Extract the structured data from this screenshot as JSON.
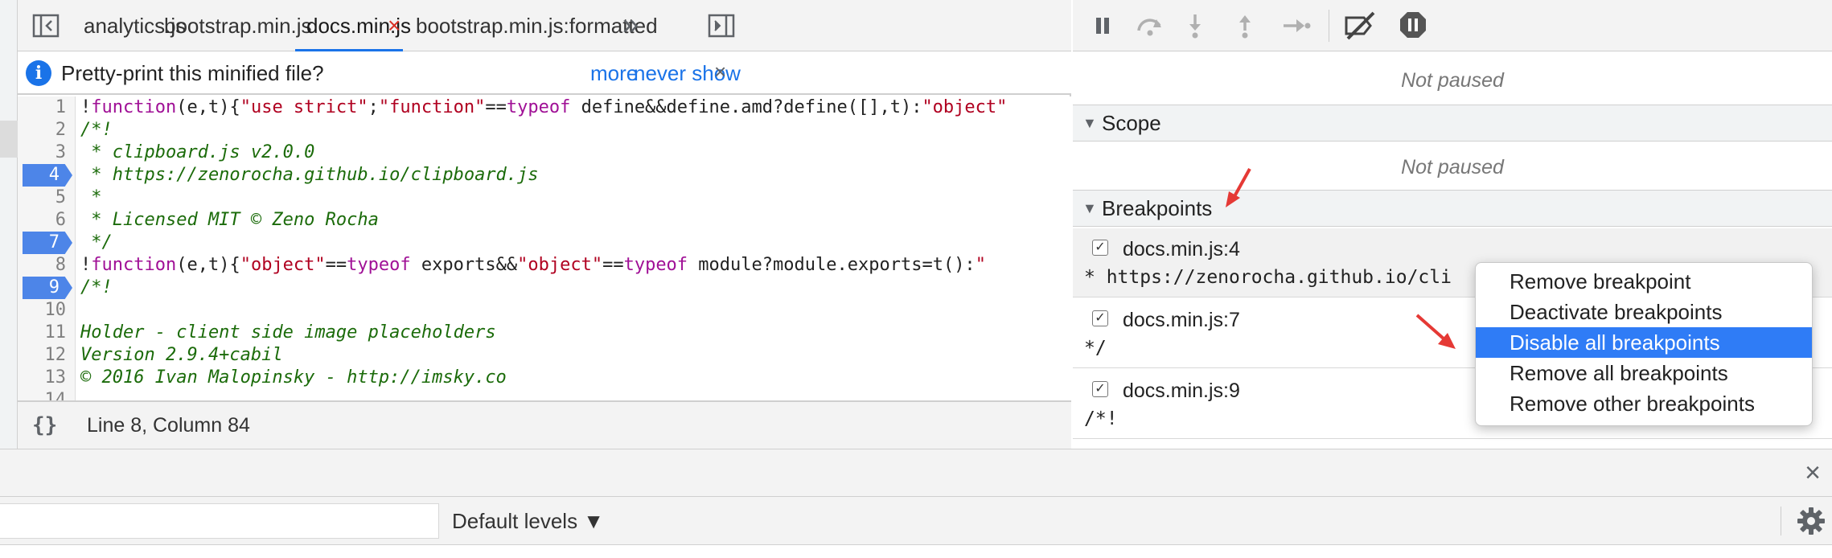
{
  "editor": {
    "tabs": [
      {
        "label": "analytics.js"
      },
      {
        "label": "bootstrap.min.js"
      },
      {
        "label": "docs.min.js",
        "active": true
      },
      {
        "label": "bootstrap.min.js:formatted"
      }
    ],
    "tab_close_glyph": "×",
    "overflow_glyph": "»",
    "infobar": {
      "message": "Pretty-print this minified file?",
      "more": "more",
      "never_show": "never show",
      "close_glyph": "×"
    },
    "lines": [
      {
        "n": "1",
        "bp": false
      },
      {
        "n": "2",
        "bp": false
      },
      {
        "n": "3",
        "bp": false
      },
      {
        "n": "4",
        "bp": true
      },
      {
        "n": "5",
        "bp": false
      },
      {
        "n": "6",
        "bp": false
      },
      {
        "n": "7",
        "bp": true
      },
      {
        "n": "8",
        "bp": false
      },
      {
        "n": "9",
        "bp": true
      },
      {
        "n": "10",
        "bp": false
      },
      {
        "n": "11",
        "bp": false
      },
      {
        "n": "12",
        "bp": false
      },
      {
        "n": "13",
        "bp": false
      },
      {
        "n": "14",
        "bp": false
      }
    ],
    "code": {
      "l1": [
        {
          "t": "!",
          "c": "pl"
        },
        {
          "t": "function",
          "c": "kw"
        },
        {
          "t": "(e,t){",
          "c": "pl"
        },
        {
          "t": "\"use strict\"",
          "c": "str"
        },
        {
          "t": ";",
          "c": "pl"
        },
        {
          "t": "\"function\"",
          "c": "str"
        },
        {
          "t": "==",
          "c": "pl"
        },
        {
          "t": "typeof",
          "c": "kw"
        },
        {
          "t": " define&&define.amd?define([],t):",
          "c": "pl"
        },
        {
          "t": "\"object\"",
          "c": "str"
        }
      ],
      "l2": "/*!",
      "l3": " * clipboard.js v2.0.0",
      "l4": " * https://zenorocha.github.io/clipboard.js",
      "l5": " *",
      "l6": " * Licensed MIT © Zeno Rocha",
      "l7": " */",
      "l8": [
        {
          "t": "!",
          "c": "pl"
        },
        {
          "t": "function",
          "c": "kw"
        },
        {
          "t": "(e,t){",
          "c": "pl"
        },
        {
          "t": "\"object\"",
          "c": "str"
        },
        {
          "t": "==",
          "c": "pl"
        },
        {
          "t": "typeof",
          "c": "kw"
        },
        {
          "t": " exports&&",
          "c": "pl"
        },
        {
          "t": "\"object\"",
          "c": "str"
        },
        {
          "t": "==",
          "c": "pl"
        },
        {
          "t": "typeof",
          "c": "kw"
        },
        {
          "t": " module?module.exports=t():",
          "c": "pl"
        },
        {
          "t": "\"",
          "c": "str"
        }
      ],
      "l9": "/*!",
      "l10": "",
      "l11": "Holder - client side image placeholders",
      "l12": "Version 2.9.4+cabil",
      "l13": "© 2016 Ivan Malopinsky - http://imsky.co"
    },
    "status": {
      "braces": "{}",
      "position": "Line 8, Column 84"
    }
  },
  "debugger": {
    "not_paused_1": "Not paused",
    "scope_label": "Scope",
    "not_paused_2": "Not paused",
    "breakpoints_label": "Breakpoints",
    "section_triangle": "▼",
    "breakpoints": [
      {
        "name": "docs.min.js:4",
        "code": "* https://zenorocha.github.io/cli",
        "checked": true
      },
      {
        "name": "docs.min.js:7",
        "code": "*/",
        "checked": true
      },
      {
        "name": "docs.min.js:9",
        "code": "/*!",
        "checked": true
      }
    ],
    "check_glyph": "✓"
  },
  "context_menu": {
    "items": [
      {
        "label": "Remove breakpoint",
        "highlighted": false
      },
      {
        "label": "Deactivate breakpoints",
        "highlighted": false
      },
      {
        "label": "Disable all breakpoints",
        "highlighted": true
      },
      {
        "label": "Remove all breakpoints",
        "highlighted": false
      },
      {
        "label": "Remove other breakpoints",
        "highlighted": false
      }
    ]
  },
  "console": {
    "drawer_close_glyph": "×",
    "filter_value": "",
    "levels_label": "Default levels ▼"
  },
  "colors": {
    "accent": "#1a73e8",
    "breakpoint": "#4d85e8",
    "menu_highlight": "#2f7cf6",
    "annotation_arrow": "#e53935"
  }
}
